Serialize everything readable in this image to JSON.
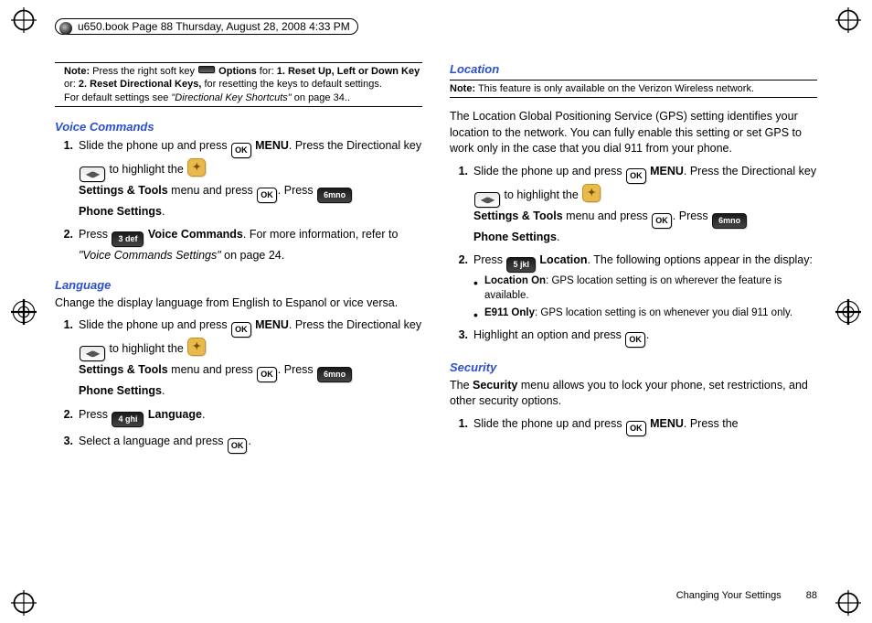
{
  "header": "u650.book  Page 88  Thursday, August 28, 2008  4:33 PM",
  "footer": {
    "section": "Changing Your Settings",
    "page": "88"
  },
  "keys": {
    "ok": "OK",
    "three": "3 def",
    "four": "4 ghi",
    "five": "5 jkl",
    "six": "6mno"
  },
  "left": {
    "note_bold": "Note:",
    "note_l1a": " Press the right soft key ",
    "note_l1b": " Options",
    "note_l1c": " for: ",
    "note_l1d": "1. Reset Up, Left or Down Key",
    "note_l2a": "or: ",
    "note_l2b": "2. Reset Directional Keys,",
    "note_l2c": " for resetting the keys to default settings.",
    "note_l3a": "For default settings see ",
    "note_l3b": "\"Directional Key Shortcuts\"",
    "note_l3c": " on page 34..",
    "voice_head": "Voice Commands",
    "voice": {
      "s1a": "Slide the phone up and press ",
      "s1b": " MENU",
      "s1c": ". Press the Directional key ",
      "s1d": " to highlight the ",
      "s1e": "Settings & Tools",
      "s1f": " menu and press ",
      "s1g": ". Press ",
      "s1h": "Phone Settings",
      "s1i": ".",
      "s2a": "Press ",
      "s2b": " Voice Commands",
      "s2c": ". For more information, refer to ",
      "s2d": "\"Voice Commands Settings\"",
      "s2e": "  on page 24."
    },
    "lang_head": "Language",
    "lang_intro": "Change the display language from English to Espanol or vice versa.",
    "lang": {
      "s1a": "Slide the phone up and press ",
      "s1b": " MENU",
      "s1c": ". Press the Directional key ",
      "s1d": " to highlight the ",
      "s1e": "Settings & Tools",
      "s1f": " menu and press ",
      "s1g": ". Press ",
      "s1h": "Phone Settings",
      "s1i": ".",
      "s2a": "Press ",
      "s2b": " Language",
      "s2c": ".",
      "s3a": "Select a language and press ",
      "s3b": "."
    }
  },
  "right": {
    "loc_head": "Location",
    "note_bold": "Note:",
    "note_text": " This feature is only available on the Verizon Wireless network.",
    "loc_intro": "The Location Global Positioning Service (GPS) setting identifies your location to the network. You can fully enable this setting or set GPS to work only in the case that you dial 911 from your phone.",
    "loc": {
      "s1a": "Slide the phone up and press ",
      "s1b": " MENU",
      "s1c": ". Press the Directional key ",
      "s1d": " to highlight the ",
      "s1e": "Settings & Tools",
      "s1f": " menu and press ",
      "s1g": ". Press ",
      "s1h": "Phone Settings",
      "s1i": ".",
      "s2a": "Press ",
      "s2b": " Location",
      "s2c": ". The following options appear in the display:",
      "b1a": "Location On",
      "b1b": ": GPS location setting is on wherever the feature is available.",
      "b2a": "E911 Only",
      "b2b": ": GPS location setting is on whenever you dial 911 only.",
      "s3a": "Highlight an option and press ",
      "s3b": "."
    },
    "sec_head": "Security",
    "sec_intro1": "The ",
    "sec_intro2": "Security",
    "sec_intro3": " menu allows you to lock your phone, set restrictions, and other security options.",
    "sec": {
      "s1a": "Slide the phone up and press ",
      "s1b": " MENU",
      "s1c": ". Press the"
    }
  }
}
